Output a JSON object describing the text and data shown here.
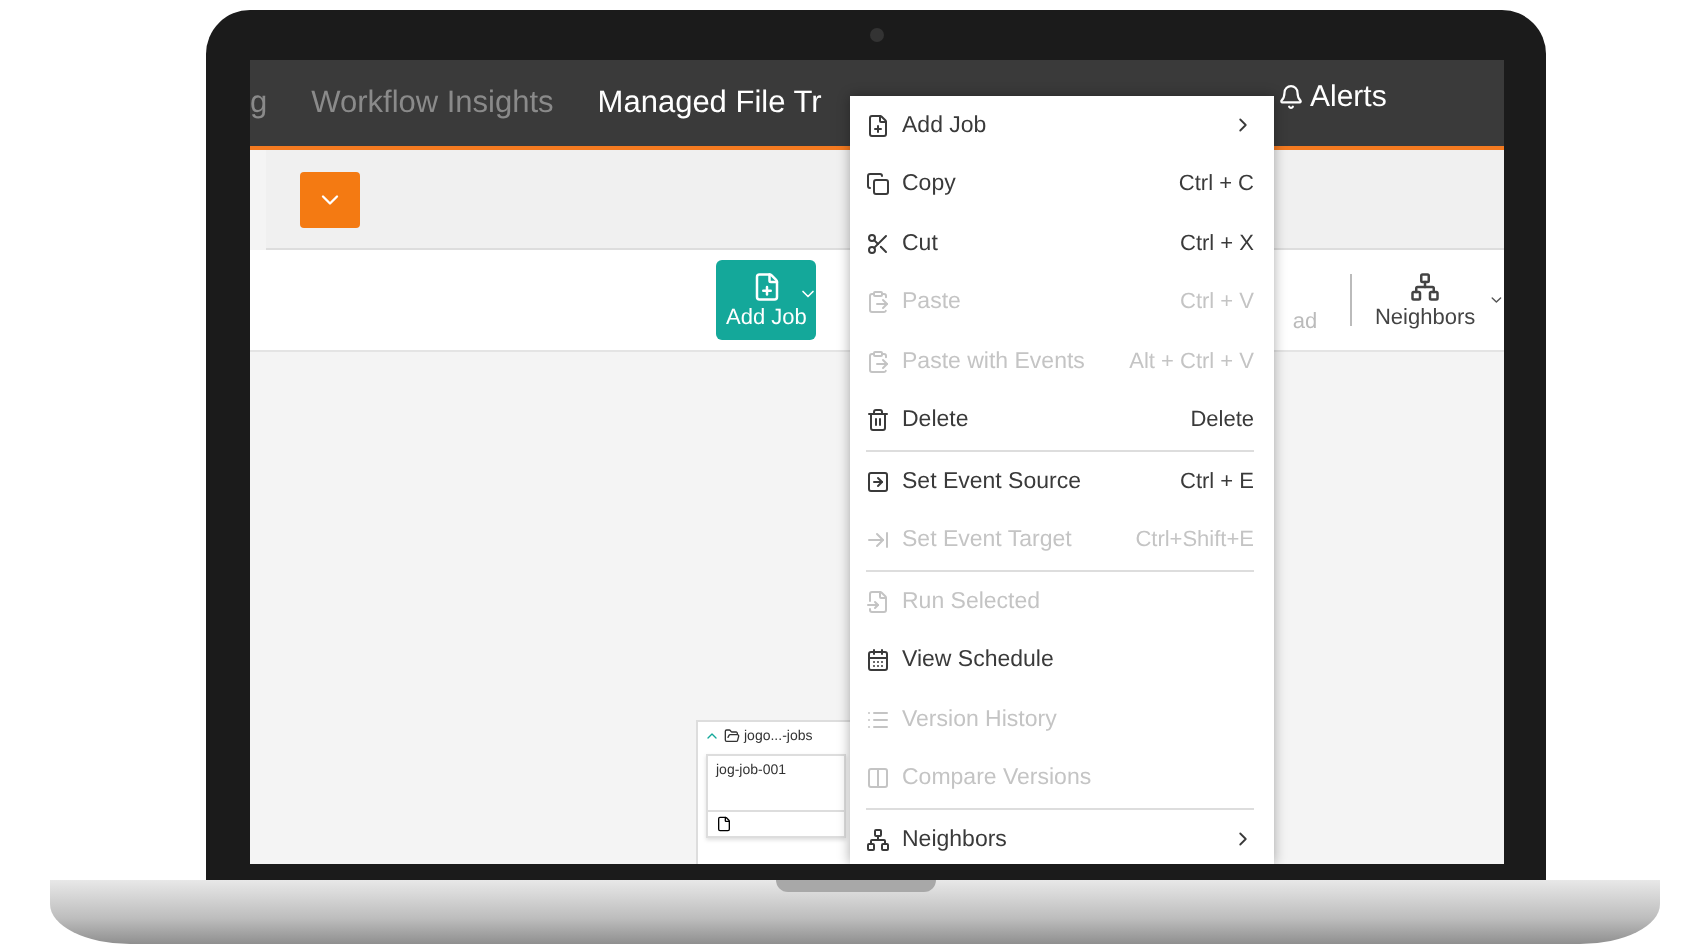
{
  "nav": {
    "items": [
      {
        "label": "g",
        "selected": false
      },
      {
        "label": "Workflow Insights",
        "selected": false
      },
      {
        "label": "Managed File Tr",
        "selected": true
      }
    ],
    "alerts": "Alerts"
  },
  "toolbar": {
    "add_job": "Add Job",
    "partial_label": "ad",
    "neighbors": "Neighbors"
  },
  "context_menu": {
    "items": [
      {
        "label": "Add Job",
        "disabled": false,
        "submenu": true,
        "separator_after": false
      },
      {
        "label": "Copy",
        "shortcut": "Ctrl + C",
        "disabled": false,
        "submenu": false,
        "separator_after": false
      },
      {
        "label": "Cut",
        "shortcut": "Ctrl + X",
        "disabled": false,
        "submenu": false,
        "separator_after": false
      },
      {
        "label": "Paste",
        "shortcut": "Ctrl + V",
        "disabled": true,
        "submenu": false,
        "separator_after": false
      },
      {
        "label": "Paste with Events",
        "shortcut": "Alt + Ctrl + V",
        "disabled": true,
        "submenu": false,
        "separator_after": false
      },
      {
        "label": "Delete",
        "shortcut": "Delete",
        "disabled": false,
        "submenu": false,
        "separator_after": true
      },
      {
        "label": "Set Event Source",
        "shortcut": "Ctrl + E",
        "disabled": false,
        "submenu": false,
        "separator_after": false
      },
      {
        "label": "Set Event Target",
        "shortcut": "Ctrl+Shift+E",
        "disabled": true,
        "submenu": false,
        "separator_after": true
      },
      {
        "label": "Run Selected",
        "disabled": true,
        "submenu": false,
        "separator_after": false
      },
      {
        "label": "View Schedule",
        "disabled": false,
        "submenu": false,
        "separator_after": false
      },
      {
        "label": "Version History",
        "disabled": true,
        "submenu": false,
        "separator_after": false
      },
      {
        "label": "Compare Versions",
        "disabled": true,
        "submenu": false,
        "separator_after": true
      },
      {
        "label": "Neighbors",
        "disabled": false,
        "submenu": true,
        "separator_after": false
      }
    ]
  },
  "node": {
    "title": "jogo...-jobs",
    "expanded": true,
    "job": "jog-job-001"
  }
}
